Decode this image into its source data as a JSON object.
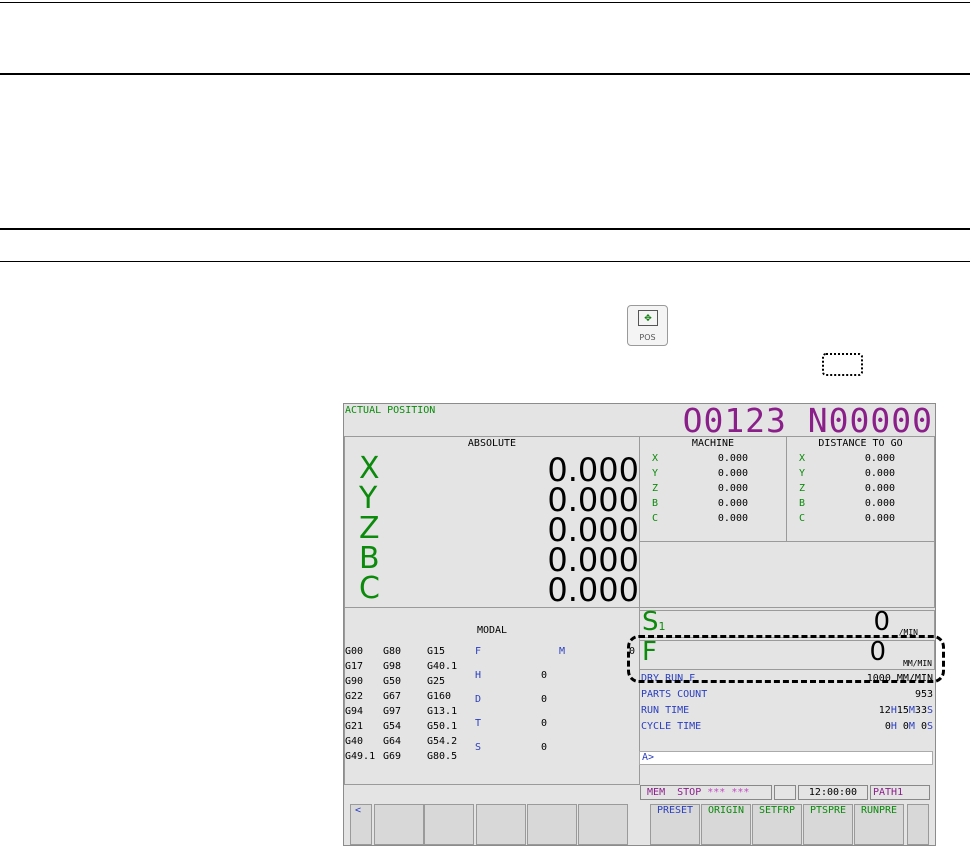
{
  "key": {
    "label": "POS",
    "glyph": "✥"
  },
  "screen": {
    "title": "ACTUAL POSITION",
    "program": "O0123 N00000",
    "absolute": {
      "header": "ABSOLUTE",
      "rows": [
        {
          "axis": "X",
          "value": "0.000"
        },
        {
          "axis": "Y",
          "value": "0.000"
        },
        {
          "axis": "Z",
          "value": "0.000"
        },
        {
          "axis": "B",
          "value": "0.000"
        },
        {
          "axis": "C",
          "value": "0.000"
        }
      ]
    },
    "machine": {
      "header": "MACHINE",
      "rows": [
        {
          "axis": "X",
          "value": "0.000"
        },
        {
          "axis": "Y",
          "value": "0.000"
        },
        {
          "axis": "Z",
          "value": "0.000"
        },
        {
          "axis": "B",
          "value": "0.000"
        },
        {
          "axis": "C",
          "value": "0.000"
        }
      ]
    },
    "distance": {
      "header": "DISTANCE TO GO",
      "rows": [
        {
          "axis": "X",
          "value": "0.000"
        },
        {
          "axis": "Y",
          "value": "0.000"
        },
        {
          "axis": "Z",
          "value": "0.000"
        },
        {
          "axis": "B",
          "value": "0.000"
        },
        {
          "axis": "C",
          "value": "0.000"
        }
      ]
    },
    "modal": {
      "header": "MODAL",
      "gcodes": [
        [
          "G00",
          "G80",
          "G15"
        ],
        [
          "G17",
          "G98",
          "G40.1"
        ],
        [
          "G90",
          "G50",
          "G25"
        ],
        [
          "G22",
          "G67",
          "G160"
        ],
        [
          "G94",
          "G97",
          "G13.1"
        ],
        [
          "G21",
          "G54",
          "G50.1"
        ],
        [
          "G40",
          "G64",
          "G54.2"
        ],
        [
          "G49.1",
          "G69",
          "G80.5"
        ]
      ],
      "letters": [
        {
          "label": "F",
          "value": ""
        },
        {
          "label": "H",
          "value": "0"
        },
        {
          "label": "D",
          "value": "0"
        },
        {
          "label": "T",
          "value": "0"
        },
        {
          "label": "S",
          "value": "0"
        }
      ],
      "m_label": "M",
      "m_value": "0"
    },
    "spindle": {
      "label": "S",
      "sub": "1",
      "value": "0",
      "unit": "/MIN"
    },
    "feed": {
      "label": "F",
      "value": "0",
      "unit": "MM/MIN"
    },
    "info": [
      {
        "label": "DRY RUN F",
        "value": "1000 MM/MIN"
      },
      {
        "label": "PARTS COUNT",
        "value": "953"
      }
    ],
    "run_time": {
      "label": "RUN TIME",
      "h": "12",
      "m": "15",
      "s": "33"
    },
    "cycle_time": {
      "label": "CYCLE TIME",
      "h": "0",
      "m": "0",
      "s": "0"
    },
    "time_units": {
      "h": "H",
      "m": "M",
      "s": "S"
    },
    "prompt": "A>",
    "status": {
      "mode": "MEM",
      "state": "STOP",
      "alarm": "*** ***",
      "clock": "12:00:00",
      "path": "PATH1"
    },
    "softkeys": {
      "prev": "<",
      "labels": [
        "PRESET",
        "ORIGIN",
        "SETFRP",
        "PTSPRE",
        "RUNPRE"
      ]
    }
  },
  "colors": {
    "green": "#0b8a0b",
    "blue": "#2a3ec0",
    "purple": "#8a1f8a",
    "screen_bg": "#e4e4e4"
  }
}
